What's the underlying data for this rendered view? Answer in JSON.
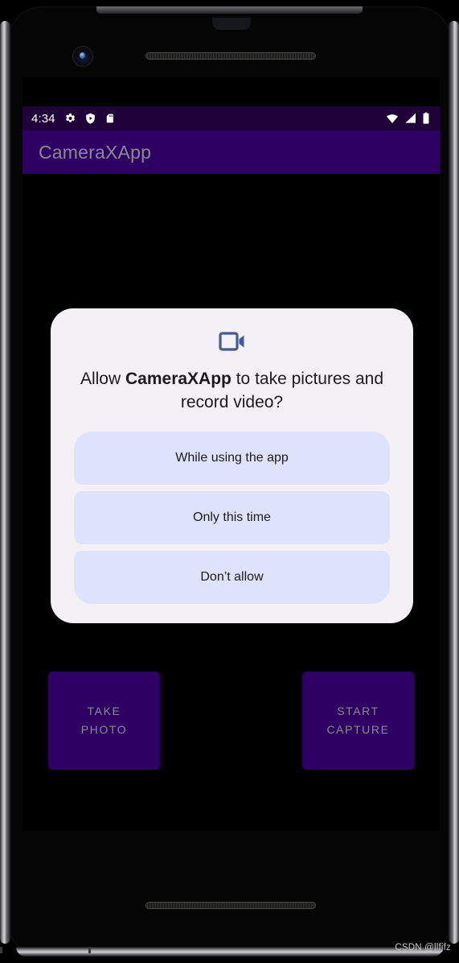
{
  "watermark": "CSDN @llfjfz",
  "status_bar": {
    "clock": "4:34",
    "left_icons": [
      "gear-icon",
      "shield-play-icon",
      "sd-card-icon"
    ],
    "right_icons": [
      "wifi-icon",
      "cellular-signal-icon",
      "battery-icon"
    ],
    "background": "#1e0238",
    "foreground": "#ffffff"
  },
  "app_bar": {
    "title": "CameraXApp",
    "background": "#2e0063",
    "title_color": "#8a8a8f"
  },
  "permission_dialog": {
    "icon": "video-camera-icon",
    "icon_color": "#455a9b",
    "background": "#f3f1f6",
    "title_prefix": "Allow ",
    "title_app": "CameraXApp",
    "title_suffix": " to take pictures and record video?",
    "options": [
      {
        "label": "While using the app",
        "name": "allow-while-using-app-button"
      },
      {
        "label": "Only this time",
        "name": "allow-only-this-time-button"
      },
      {
        "label": "Don’t allow",
        "name": "deny-button"
      }
    ],
    "option_background": "#dfe2fb",
    "option_text_color": "#1b1b1f"
  },
  "actions": [
    {
      "label": "TAKE\nPHOTO",
      "name": "take-photo-button"
    },
    {
      "label": "START\nCAPTURE",
      "name": "start-capture-button"
    }
  ],
  "action_style": {
    "background": "#2e0063",
    "text_color": "#8a8a8f"
  },
  "system_nav": {
    "home_indicator": "home-indicator-bar"
  }
}
